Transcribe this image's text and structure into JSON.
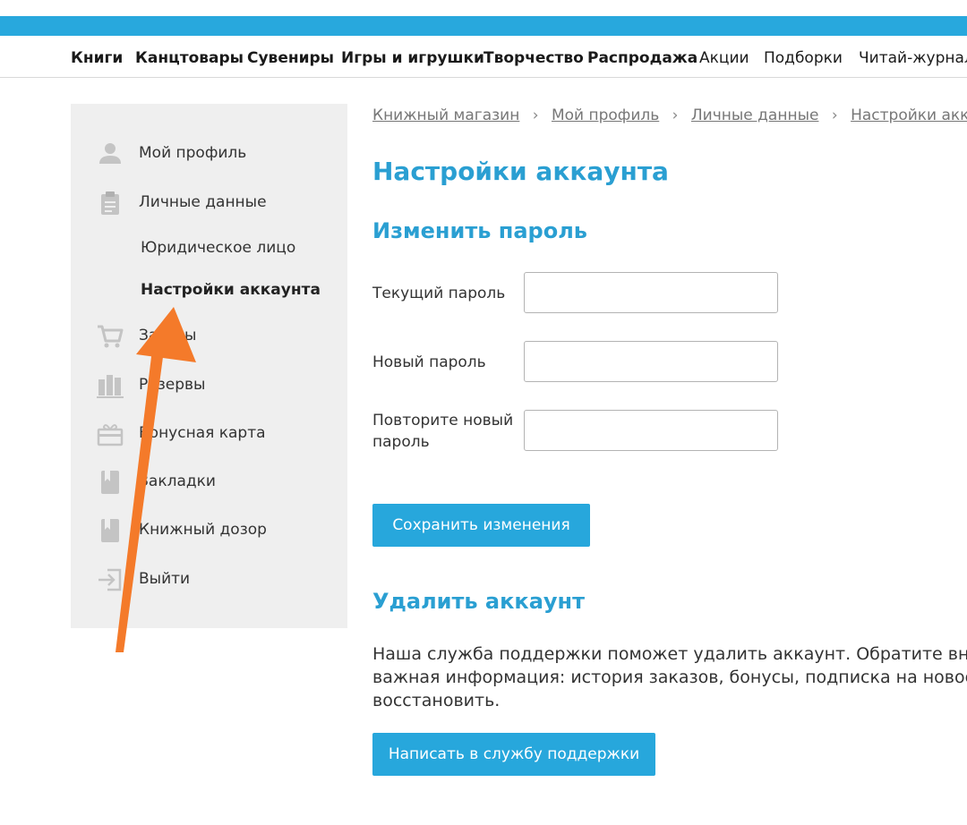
{
  "nav": [
    {
      "label": "Книги",
      "bold": true
    },
    {
      "label": "Канцтовары",
      "bold": true
    },
    {
      "label": "Сувениры",
      "bold": true
    },
    {
      "label": "Игры и игрушки",
      "bold": true
    },
    {
      "label": "Творчество",
      "bold": true
    },
    {
      "label": "Распродажа",
      "bold": true
    },
    {
      "label": "Акции",
      "bold": false
    },
    {
      "label": "Подборки",
      "bold": false
    },
    {
      "label": "Читай-журнал",
      "bold": false
    }
  ],
  "sidebar": {
    "items": [
      {
        "label": "Мой профиль",
        "icon": "user-icon"
      },
      {
        "label": "Личные данные",
        "icon": "clipboard-icon"
      },
      {
        "label": "Юридическое лицо",
        "sub": true
      },
      {
        "label": "Настройки аккаунта",
        "sub": true,
        "active": true
      },
      {
        "label": "Заказы",
        "icon": "cart-icon"
      },
      {
        "label": "Резервы",
        "icon": "books-icon"
      },
      {
        "label": "Бонусная карта",
        "icon": "gift-card-icon"
      },
      {
        "label": "Закладки",
        "icon": "bookmark-icon"
      },
      {
        "label": "Книжный дозор",
        "icon": "bookmark-icon"
      },
      {
        "label": "Выйти",
        "icon": "logout-icon"
      }
    ]
  },
  "breadcrumb": [
    "Книжный магазин",
    "Мой профиль",
    "Личные данные",
    "Настройки аккаунта"
  ],
  "breadcrumb_separator": "›",
  "page": {
    "title": "Настройки аккаунта",
    "password_section": {
      "title": "Изменить пароль",
      "fields": [
        {
          "label": "Текущий пароль",
          "value": ""
        },
        {
          "label": "Новый пароль",
          "value": ""
        },
        {
          "label": "Повторите новый пароль",
          "value": ""
        }
      ],
      "save_label": "Сохранить изменения"
    },
    "delete_section": {
      "title": "Удалить аккаунт",
      "text_lines": [
        "Наша служба поддержки поможет удалить аккаунт. Обратите внимание",
        "важная информация: история заказов, бонусы, подписка на новости",
        "восстановить."
      ],
      "support_label": "Написать в службу поддержки"
    }
  },
  "colors": {
    "brand": "#28a8dd",
    "heading": "#2a9fd2",
    "arrow": "#f47a2a",
    "sidebar_bg": "#efefef"
  }
}
